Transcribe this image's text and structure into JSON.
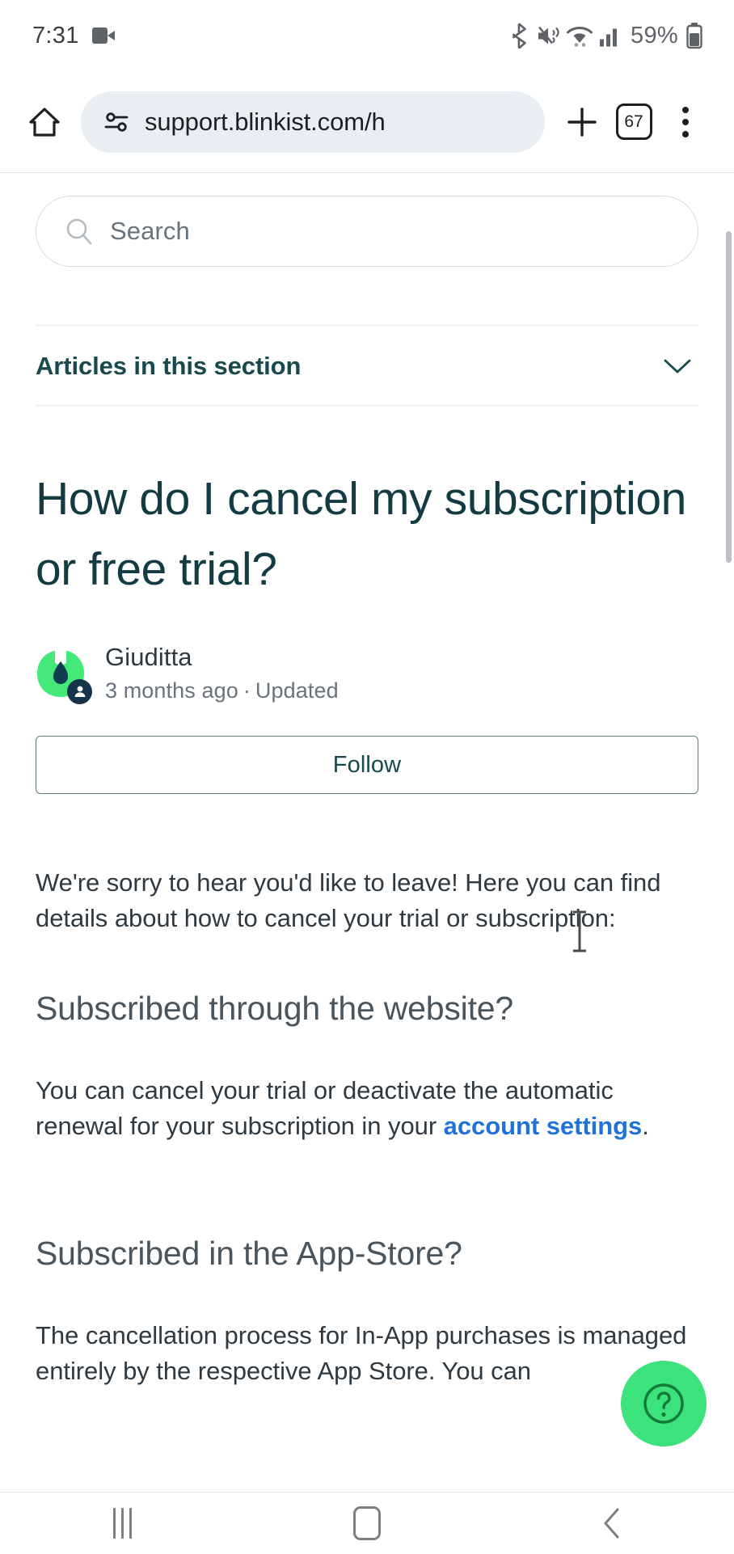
{
  "status_bar": {
    "time": "7:31",
    "battery_percent": "59%",
    "icons": [
      "video-camera-icon",
      "bluetooth-icon",
      "mute-vibrate-icon",
      "wifi-icon",
      "cellular-signal-icon",
      "battery-icon"
    ]
  },
  "browser": {
    "home_icon": "home-icon",
    "site_settings_icon": "tune-icon",
    "url": "support.blinkist.com/h",
    "new_tab_label": "+",
    "tab_count": "67",
    "menu_icon": "more-vertical-icon"
  },
  "search": {
    "placeholder": "Search",
    "icon": "search-icon"
  },
  "section": {
    "articles_label": "Articles in this section",
    "expand_icon": "chevron-down-icon"
  },
  "article": {
    "title": "How do I cancel my subscription or free trial?",
    "author": "Giuditta",
    "time_ago": "3 months ago",
    "separator": "·",
    "updated_label": "Updated",
    "follow_label": "Follow",
    "avatar_icon": "blinkist-leaf-avatar",
    "badge_icon": "person-icon",
    "paragraphs": {
      "intro": "We're sorry to hear you'd like to leave! Here you can find details about how to cancel your trial or subscription:",
      "website_heading": "Subscribed through the website?",
      "website_body_before": "You can cancel your trial or deactivate the automatic renewal for your subscription in your ",
      "website_link": "account settings",
      "website_body_after": ".",
      "appstore_heading": "Subscribed in the App-Store?",
      "appstore_body": "The cancellation process for In-App purchases is managed entirely by the respective App Store. You can"
    }
  },
  "help_fab": {
    "icon": "question-mark-circle-icon",
    "label": "?"
  },
  "nav_bar": {
    "recents_icon": "recents-icon",
    "home_icon": "home-square-icon",
    "back_icon": "back-chevron-icon"
  },
  "colors": {
    "brand_green": "#3ce37c",
    "link_blue": "#1f73d6",
    "heading_teal": "#17494d",
    "omnibox_bg": "#e9eef2"
  }
}
